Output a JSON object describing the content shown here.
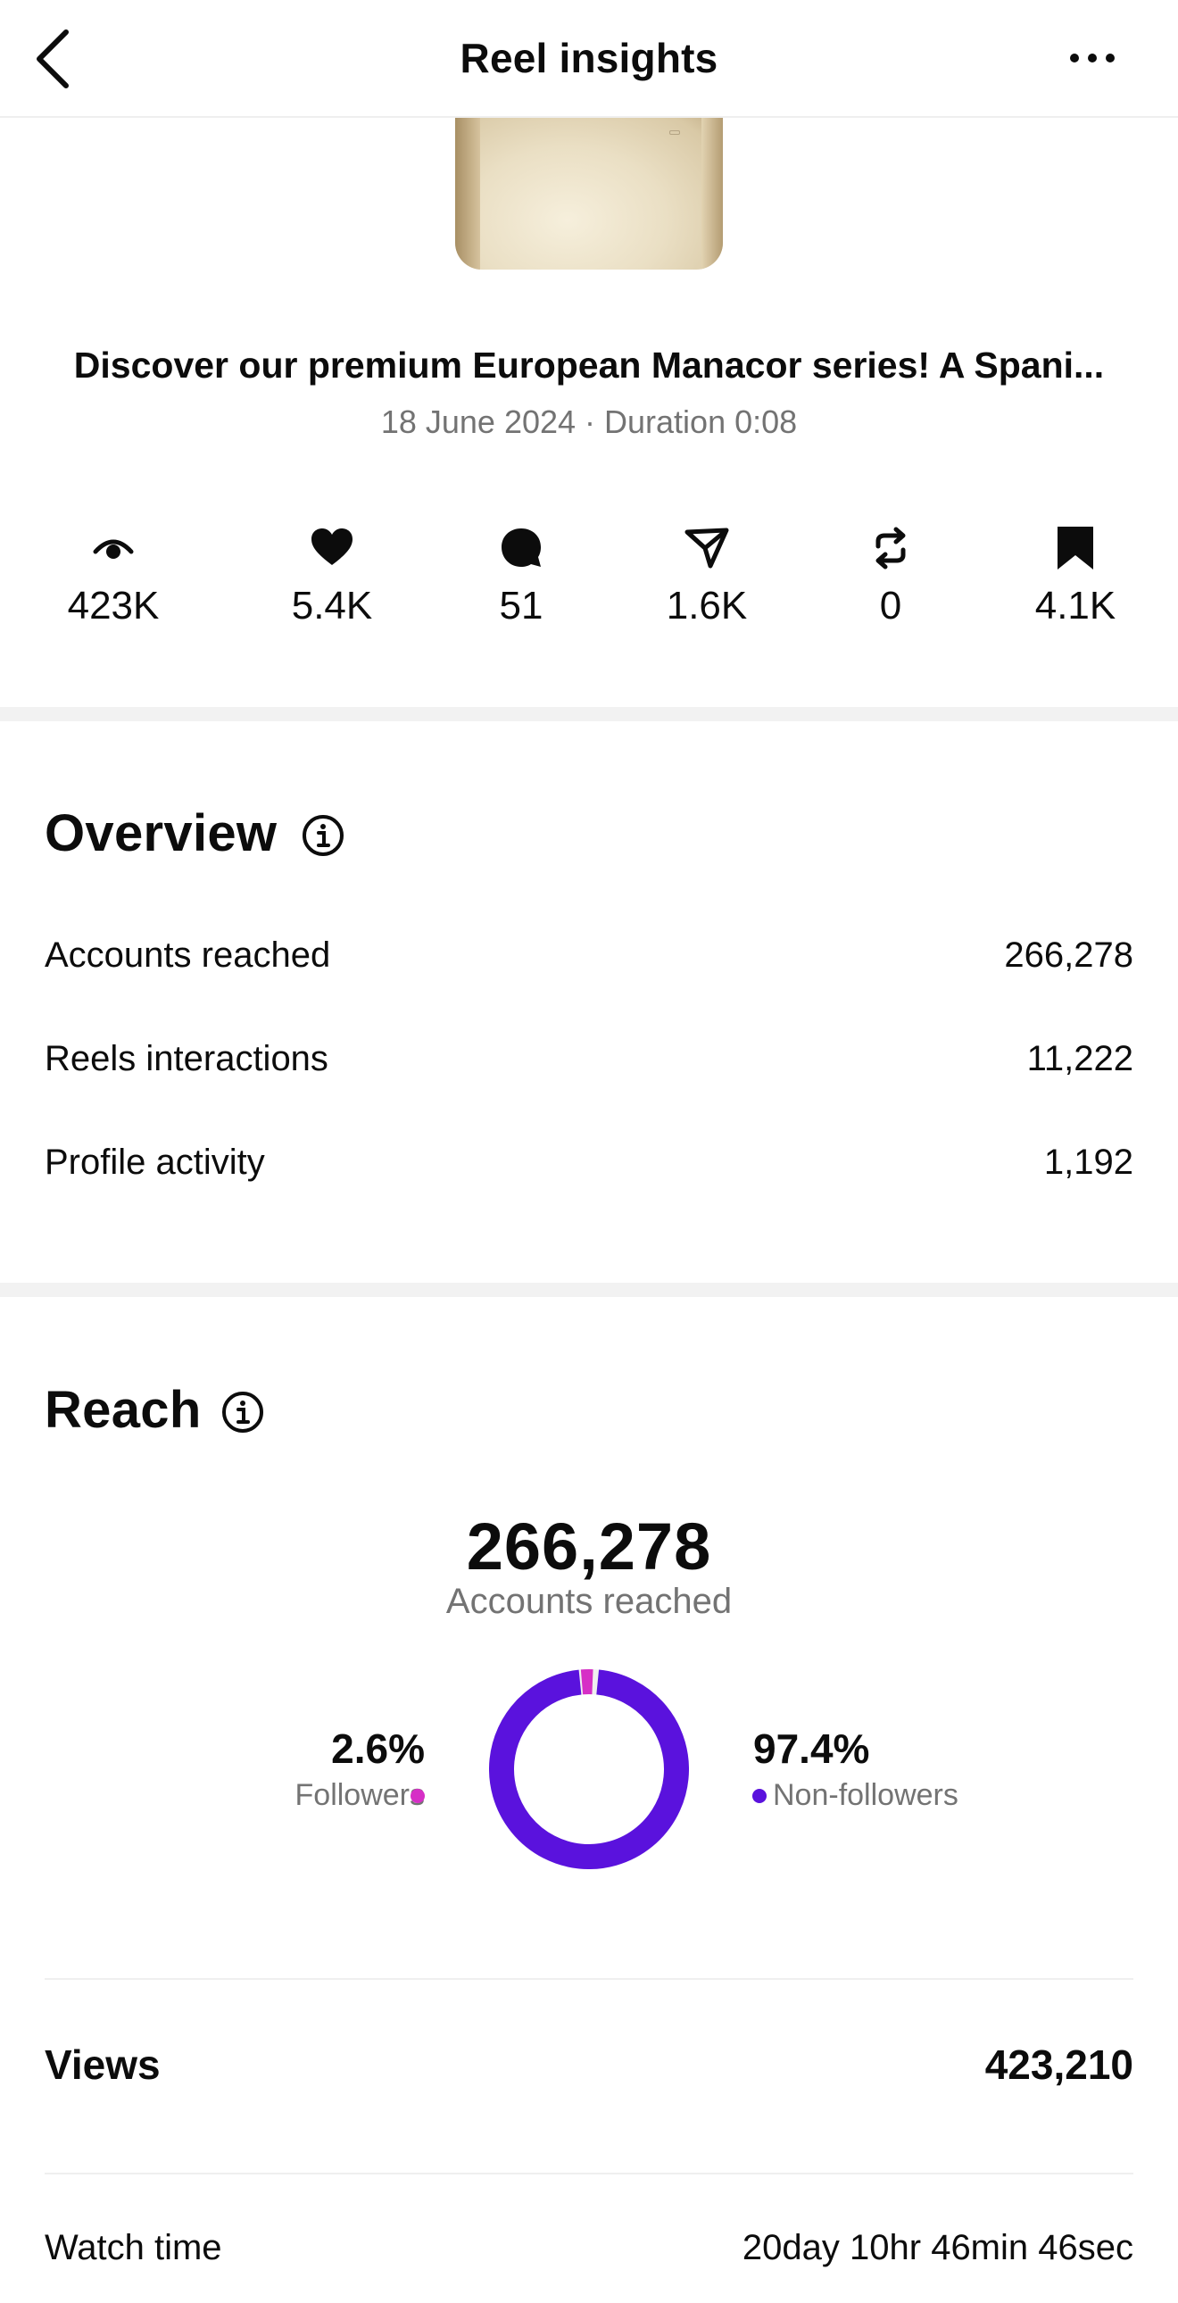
{
  "header": {
    "title": "Reel insights",
    "back_icon": "chevron-left-icon",
    "more_icon": "more-horizontal-icon"
  },
  "post": {
    "caption": "Discover our premium European Manacor series! A Spani...",
    "meta": "18 June 2024 · Duration 0:08"
  },
  "stats": [
    {
      "icon": "eye-icon",
      "value": "423K"
    },
    {
      "icon": "heart-icon",
      "value": "5.4K"
    },
    {
      "icon": "comment-icon",
      "value": "51"
    },
    {
      "icon": "share-icon",
      "value": "1.6K"
    },
    {
      "icon": "repost-icon",
      "value": "0"
    },
    {
      "icon": "bookmark-icon",
      "value": "4.1K"
    }
  ],
  "overview": {
    "title": "Overview",
    "rows": [
      {
        "label": "Accounts reached",
        "value": "266,278"
      },
      {
        "label": "Reels interactions",
        "value": "11,222"
      },
      {
        "label": "Profile activity",
        "value": "1,192"
      }
    ]
  },
  "reach": {
    "title": "Reach",
    "total": "266,278",
    "total_label": "Accounts reached",
    "followers": {
      "pct_text": "2.6%",
      "label": "Followers",
      "pct": 2.6,
      "color": "#d62fc6"
    },
    "non_followers": {
      "pct_text": "97.4%",
      "label": "Non-followers",
      "pct": 97.4,
      "color": "#5a12dd"
    }
  },
  "views": {
    "label": "Views",
    "value": "423,210"
  },
  "watch_time": {
    "label": "Watch time",
    "value": "20day 10hr 46min 46sec"
  }
}
